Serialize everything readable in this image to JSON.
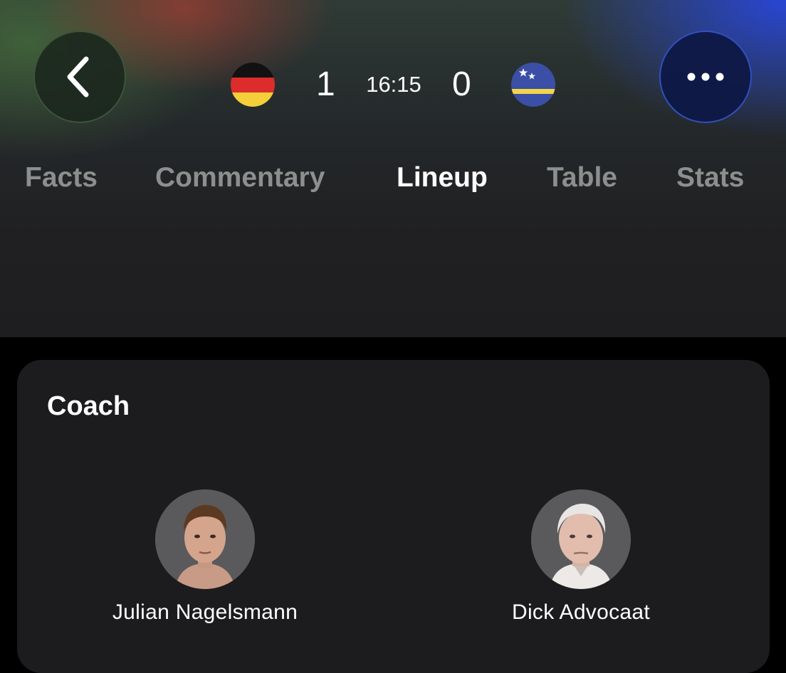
{
  "header": {
    "back_icon": "chevron-left-icon",
    "more_icon": "ellipsis-icon",
    "home_team": {
      "flag": "germany-flag",
      "score": "1"
    },
    "away_team": {
      "flag": "curacao-flag",
      "score": "0"
    },
    "match_time": "16:15"
  },
  "tabs": [
    {
      "label": "Facts",
      "active": false
    },
    {
      "label": "Commentary",
      "active": false
    },
    {
      "label": "Lineup",
      "active": true
    },
    {
      "label": "Table",
      "active": false
    },
    {
      "label": "Stats",
      "active": false
    }
  ],
  "coach_section": {
    "title": "Coach",
    "coaches": [
      {
        "name": "Julian Nagelsmann",
        "icon": "coach-photo-avatar"
      },
      {
        "name": "Dick Advocaat",
        "icon": "coach-photo-avatar"
      }
    ]
  },
  "colors": {
    "background": "#000000",
    "card": "#1c1c1e",
    "tab_inactive": "#8b8f8e",
    "tab_active": "#ffffff",
    "more_button_accent": "#3c64e6"
  }
}
